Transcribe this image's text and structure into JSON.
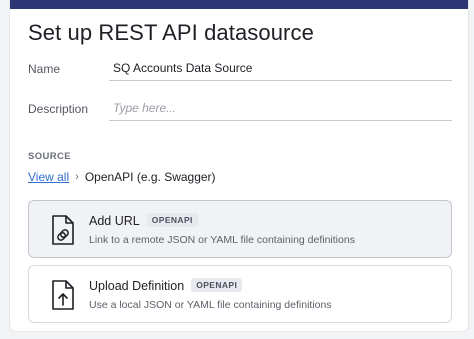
{
  "header": {
    "title": "Set up REST API datasource"
  },
  "form": {
    "name_label": "Name",
    "name_value": "SQ Accounts Data Source",
    "description_label": "Description",
    "description_placeholder": "Type here..."
  },
  "source": {
    "section_label": "SOURCE",
    "breadcrumb_link": "View all",
    "breadcrumb_current": "OpenAPI (e.g. Swagger)"
  },
  "options": [
    {
      "title": "Add URL",
      "badge": "OPENAPI",
      "description": "Link to a remote JSON or YAML file containing definitions",
      "icon": "link-file-icon",
      "selected": true
    },
    {
      "title": "Upload Definition",
      "badge": "OPENAPI",
      "description": "Use a local JSON or YAML file containing definitions",
      "icon": "upload-file-icon",
      "selected": false
    }
  ],
  "colors": {
    "header_bar": "#2e3574",
    "link": "#2f6fd1",
    "selected_card": "#f1f2f5"
  }
}
